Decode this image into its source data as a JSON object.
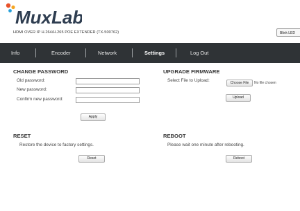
{
  "header": {
    "brand": "MuxLab",
    "product": "HDMI OVER IP H.264/H.265 POE EXTENDER (TX-500762)",
    "blink_led_label": "Blink LED"
  },
  "nav": {
    "items": [
      {
        "label": "Info"
      },
      {
        "label": "Encoder"
      },
      {
        "label": "Network"
      },
      {
        "label": "Settings"
      },
      {
        "label": "Log Out"
      }
    ],
    "active": "Settings"
  },
  "change_password": {
    "title": "CHANGE PASSWORD",
    "old_label": "Old password:",
    "new_label": "New password:",
    "confirm_label": "Confirm new password:",
    "apply_label": "Apply"
  },
  "upgrade_firmware": {
    "title": "UPGRADE FIRMWARE",
    "select_label": "Select File to Upload:",
    "choose_file_label": "Choose File",
    "file_status": "No file chosen",
    "upload_label": "Upload"
  },
  "reset": {
    "title": "RESET",
    "description": "Restore the device to factory settings.",
    "button_label": "Reset"
  },
  "reboot": {
    "title": "REBOOT",
    "description": "Please wait one minute after rebooting.",
    "button_label": "Reboot"
  },
  "colors": {
    "navbar_bg": "#2f3336",
    "logo_dots": [
      "#e8522a",
      "#f5a623",
      "#26a0da"
    ],
    "brand_text": "#2e3d50"
  }
}
